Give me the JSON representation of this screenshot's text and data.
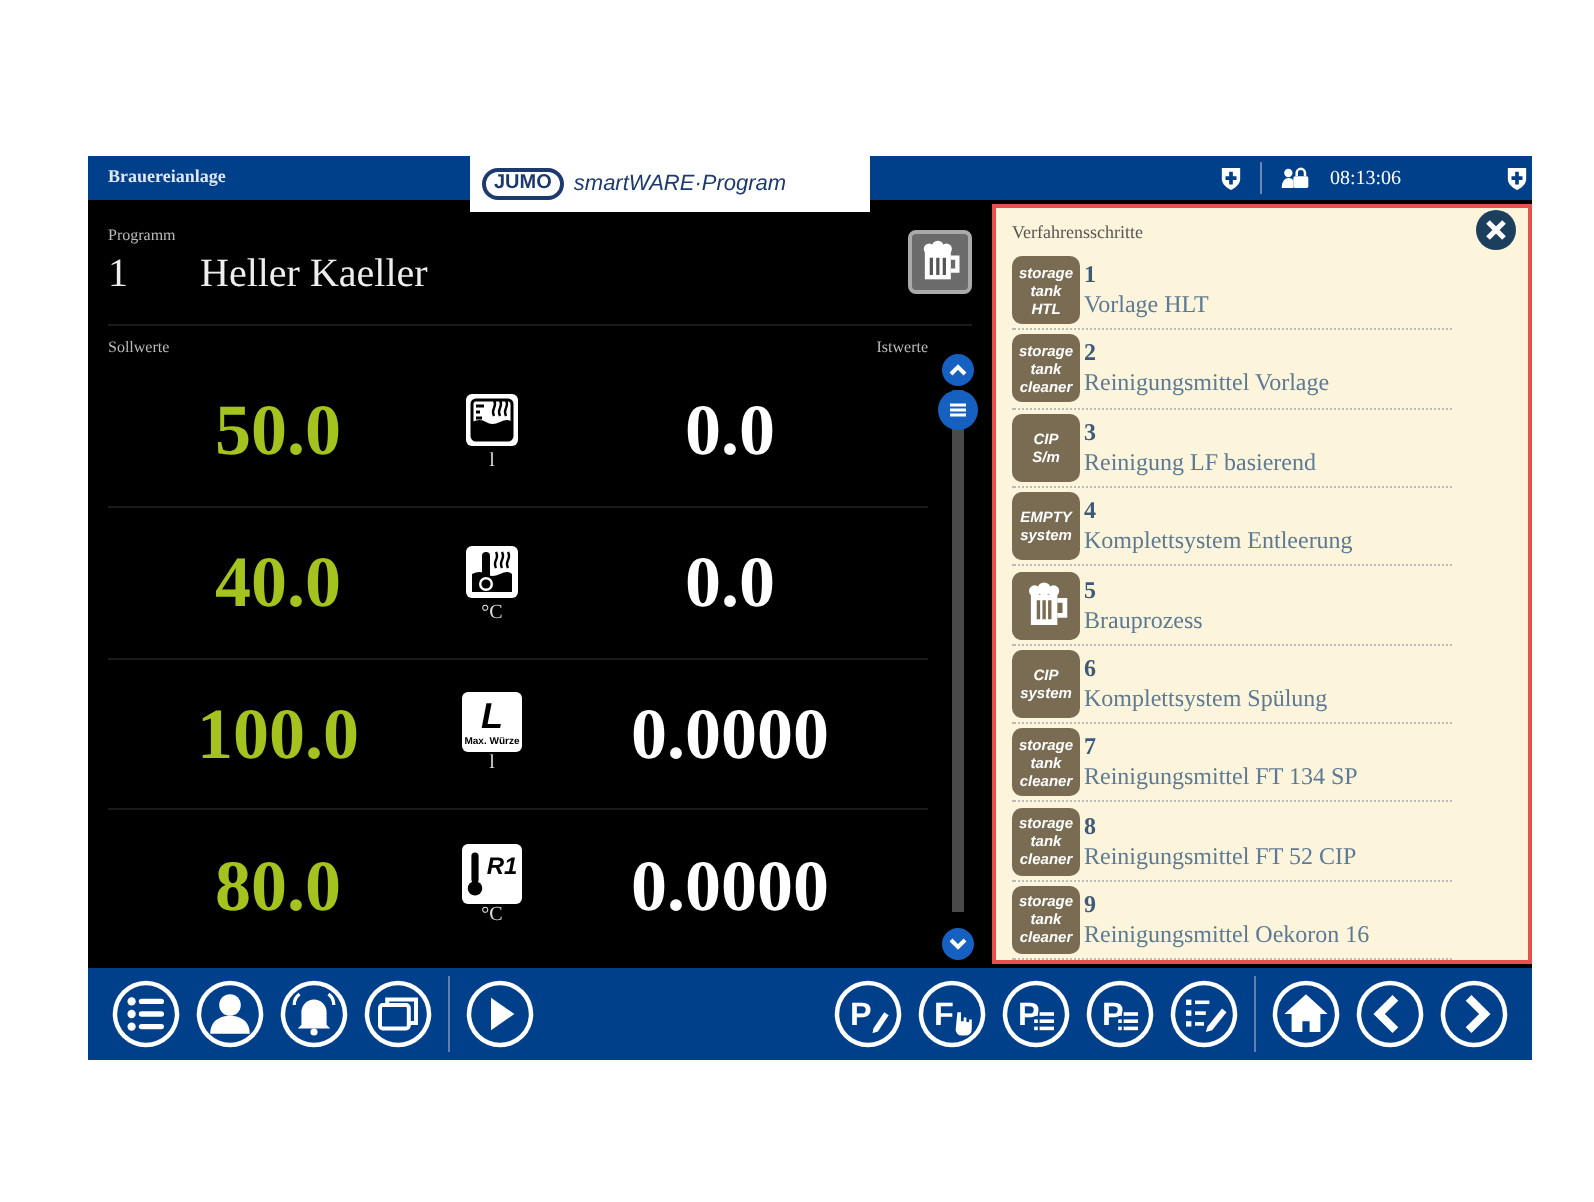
{
  "header": {
    "title": "Brauereianlage",
    "logo": {
      "brand": "JUMO",
      "product": "smartWARE·Program"
    },
    "time": "08:13:06"
  },
  "program": {
    "label": "Programm",
    "number": "1",
    "name": "Heller Kaeller"
  },
  "values": {
    "setpoint_label": "Sollwerte",
    "actual_label": "Istwerte",
    "rows": [
      {
        "setpoint": "50.0",
        "kind": "level-tank",
        "unit": "l",
        "actual": "0.0"
      },
      {
        "setpoint": "40.0",
        "kind": "temp-tank",
        "unit": "°C",
        "actual": "0.0"
      },
      {
        "setpoint": "100.0",
        "kind": "level-max",
        "icon_text": "L",
        "icon_subtext": "Max. Würze",
        "unit": "l",
        "actual": "0.0000"
      },
      {
        "setpoint": "80.0",
        "kind": "temp-r1",
        "icon_text": "R1",
        "unit": "°C",
        "actual": "0.0000"
      }
    ]
  },
  "steps": {
    "title": "Verfahrensschritte",
    "items": [
      {
        "kind": "badge",
        "badge": [
          "storage",
          "tank",
          "HTL"
        ],
        "number": "1",
        "name": "Vorlage HLT"
      },
      {
        "kind": "badge",
        "badge": [
          "storage",
          "tank",
          "cleaner"
        ],
        "number": "2",
        "name": "Reinigungsmittel Vorlage"
      },
      {
        "kind": "badge",
        "badge": [
          "CIP",
          "S/m"
        ],
        "number": "3",
        "name": "Reinigung LF basierend"
      },
      {
        "kind": "badge",
        "badge": [
          "EMPTY",
          "system"
        ],
        "number": "4",
        "name": "Komplettsystem Entleerung"
      },
      {
        "kind": "beer",
        "number": "5",
        "name": "Brauprozess"
      },
      {
        "kind": "badge",
        "badge": [
          "CIP",
          "system"
        ],
        "number": "6",
        "name": "Komplettsystem Spülung"
      },
      {
        "kind": "badge",
        "badge": [
          "storage",
          "tank",
          "cleaner"
        ],
        "number": "7",
        "name": "Reinigungsmittel FT 134 SP"
      },
      {
        "kind": "badge",
        "badge": [
          "storage",
          "tank",
          "cleaner"
        ],
        "number": "8",
        "name": "Reinigungsmittel FT 52 CIP"
      },
      {
        "kind": "badge",
        "badge": [
          "storage",
          "tank",
          "cleaner"
        ],
        "number": "9",
        "name": "Reinigungsmittel Oekoron 16"
      }
    ]
  },
  "toolbar": [
    {
      "kind": "list"
    },
    {
      "kind": "user"
    },
    {
      "kind": "bell"
    },
    {
      "kind": "windows"
    },
    {
      "kind": "sep"
    },
    {
      "kind": "play"
    },
    {
      "kind": "gap"
    },
    {
      "kind": "letter-pencil",
      "letter": "P"
    },
    {
      "kind": "letter-hand",
      "letter": "F"
    },
    {
      "kind": "letter-list",
      "letter": "P"
    },
    {
      "kind": "letter-list",
      "letter": "P"
    },
    {
      "kind": "list-pencil"
    },
    {
      "kind": "sep"
    },
    {
      "kind": "home"
    },
    {
      "kind": "back"
    },
    {
      "kind": "forward"
    }
  ]
}
